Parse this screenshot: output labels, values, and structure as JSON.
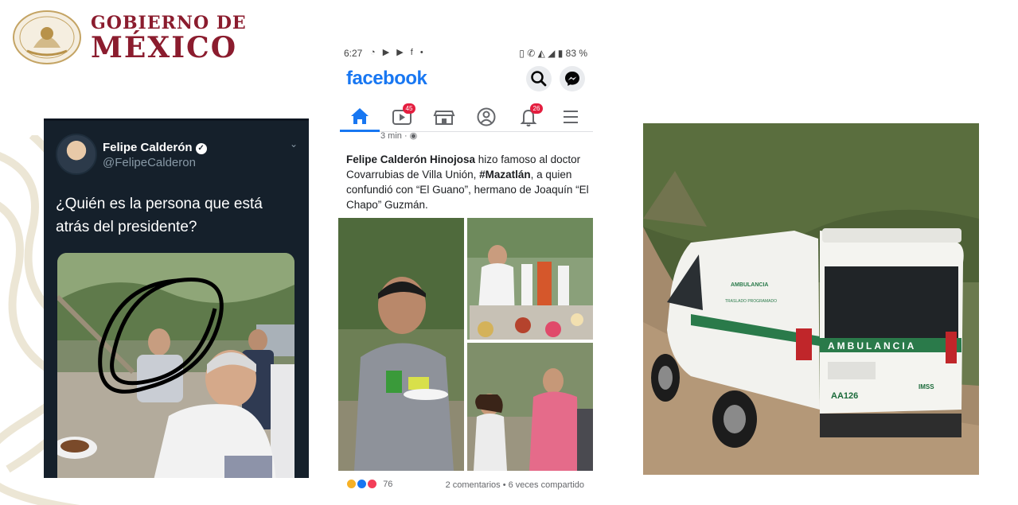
{
  "header": {
    "logo_line1": "GOBIERNO DE",
    "logo_line2": "MÉXICO",
    "seal_icon": "coat-of-arms-seal",
    "brand_color": "#8b1c2e"
  },
  "tweet": {
    "name": "Felipe Calderón",
    "verified": "✓",
    "handle": "@FelipeCalderon",
    "chevron": "⌄",
    "text": "¿Quién es la persona que está atrás del presidente?",
    "background": "#15202b"
  },
  "facebook": {
    "status": {
      "time": "6:27",
      "apps": "◔ ▶ ▶ f •",
      "right": "▯ ✆ ◭ ◢ ▮ 83 %"
    },
    "logo": "facebook",
    "search_icon": "search-icon",
    "messenger_icon": "messenger-icon",
    "tabs": [
      {
        "icon": "home-icon",
        "badge": ""
      },
      {
        "icon": "video-icon",
        "badge": "45"
      },
      {
        "icon": "marketplace-icon",
        "badge": ""
      },
      {
        "icon": "profile-icon",
        "badge": ""
      },
      {
        "icon": "bell-icon",
        "badge": "26"
      },
      {
        "icon": "menu-icon",
        "badge": ""
      }
    ],
    "post": {
      "time": "3 min · ◉",
      "author": "Felipe Calderón Hinojosa",
      "text_1": " hizo famoso al doctor Covarrubias de Villa Unión, ",
      "hashtag": "#Mazatlán",
      "text_2": ", a quien confundió con “El Guano”, hermano de Joaquín “El Chapo” Guzmán.",
      "reactions_count": "76",
      "stats": "2 comentarios • 6 veces compartido"
    },
    "accent": "#1877f2"
  },
  "ambulance_photo": {
    "side_label": "AMBULANCIA",
    "side_sublabel": "TRASLADO PROGRAMADO",
    "rear_label": "AMBULANCIA",
    "plate": "AA126",
    "brand": "IMSS"
  }
}
